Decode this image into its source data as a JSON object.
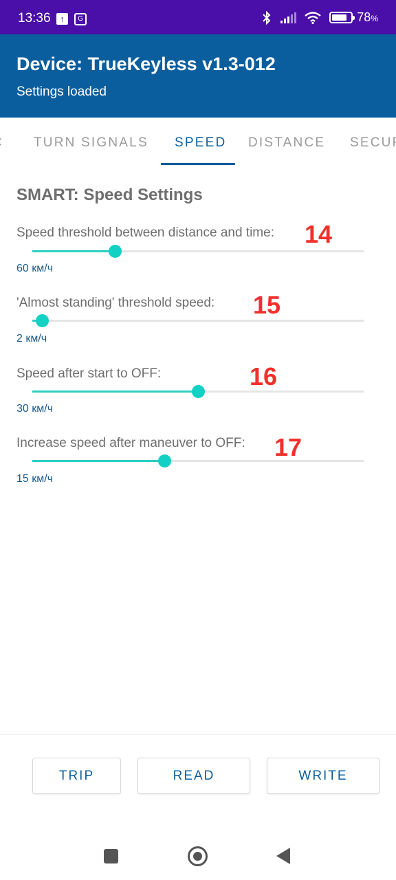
{
  "status_bar": {
    "time": "13:36",
    "translate_glyph": "G",
    "battery_percent": 78,
    "battery_text": "78",
    "battery_unit": "%"
  },
  "app_bar": {
    "title": "Device: TrueKeyless v1.3-012",
    "subtitle": "Settings loaded"
  },
  "tabs": [
    {
      "label": "C"
    },
    {
      "label": "TURN SIGNALS"
    },
    {
      "label": "SPEED",
      "active": true
    },
    {
      "label": "DISTANCE"
    },
    {
      "label": "SECURITY"
    }
  ],
  "section_title": "SMART: Speed Settings",
  "settings": [
    {
      "label": "Speed threshold between distance and time:",
      "number": "14",
      "value": "60 км/ч",
      "fill_fraction": 0.25
    },
    {
      "label": "'Almost standing' threshold speed:",
      "number": "15",
      "value": "2 км/ч",
      "fill_fraction": 0.03
    },
    {
      "label": "Speed after start to OFF:",
      "number": "16",
      "value": "30 км/ч",
      "fill_fraction": 0.5
    },
    {
      "label": "Increase speed after maneuver to OFF:",
      "number": "17",
      "value": "15 км/ч",
      "fill_fraction": 0.4
    }
  ],
  "buttons": {
    "trip": "TRIP",
    "read": "READ",
    "write": "WRITE"
  },
  "colors": {
    "status_bar": "#4a0fa8",
    "app_bar": "#0a5e9e",
    "accent": "#0a5e9e",
    "slider": "#11d1c4",
    "annotation": "#f1302b"
  },
  "icons": {
    "upload": "upload-icon",
    "translate": "translate-icon",
    "bluetooth": "bluetooth-icon",
    "signal": "signal-icon",
    "wifi": "wifi-icon",
    "battery": "battery-icon",
    "nav_recents": "square-icon",
    "nav_home": "circle-icon",
    "nav_back": "triangle-back-icon"
  }
}
